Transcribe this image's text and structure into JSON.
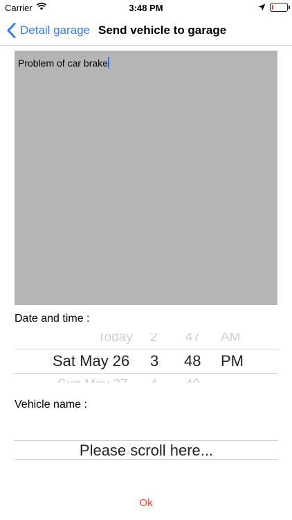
{
  "status_bar": {
    "carrier": "Carrier",
    "time": "3:48 PM",
    "battery_fraction": 0.12,
    "battery_color": "#ff3b30",
    "icons": [
      "wifi-icon",
      "location-arrow-icon",
      "battery-icon"
    ]
  },
  "nav": {
    "back_label": "Detail garage",
    "title": "Send vehicle to garage",
    "accent_color": "#2f7cf6"
  },
  "problem": {
    "text": "Problem of car brake",
    "background_color": "#b5b5b5"
  },
  "date_time": {
    "label": "Date and time :",
    "rows": [
      {
        "day": "Today",
        "hour": "2",
        "minute": "47",
        "ampm": "AM",
        "state": "previous"
      },
      {
        "day": "Sat May 26",
        "hour": "3",
        "minute": "48",
        "ampm": "PM",
        "state": "selected"
      },
      {
        "day": "Sun May 27",
        "hour": "4",
        "minute": "49",
        "ampm": "",
        "state": "next"
      }
    ]
  },
  "vehicle": {
    "label": "Vehicle name :",
    "picker_text": "Please scroll here..."
  },
  "ok_label": "Ok",
  "ok_color": "#ff3b30"
}
